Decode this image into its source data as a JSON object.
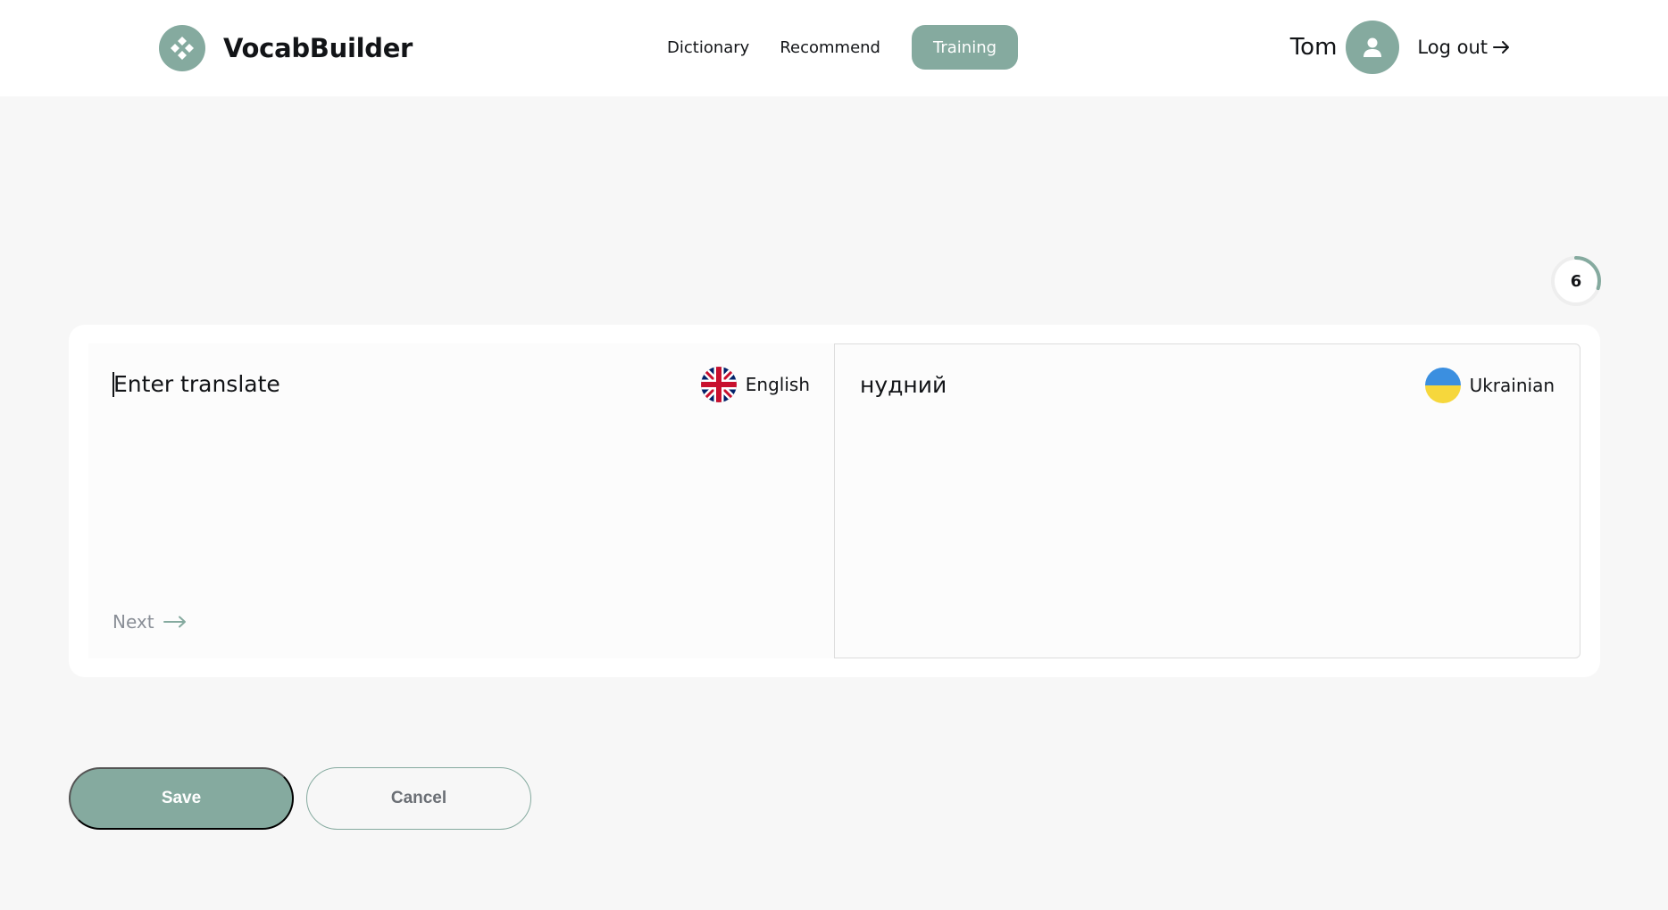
{
  "header": {
    "logo_text": "VocabBuilder",
    "logo_icon": "diamond-petals-icon",
    "nav": [
      {
        "label": "Dictionary",
        "active": false
      },
      {
        "label": "Recommend",
        "active": false
      },
      {
        "label": "Training",
        "active": true
      }
    ],
    "user_name": "Tom",
    "logout_label": "Log out"
  },
  "progress": {
    "count": "6",
    "fraction": 0.3
  },
  "training": {
    "input_placeholder": "Enter translate",
    "source_language": "English",
    "target_word": "нудний",
    "target_language": "Ukrainian",
    "next_label": "Next"
  },
  "actions": {
    "save_label": "Save",
    "cancel_label": "Cancel"
  },
  "colors": {
    "accent": "#85aa9f",
    "text": "#121417",
    "muted": "#8a8f97",
    "background": "#f7f7f7"
  }
}
